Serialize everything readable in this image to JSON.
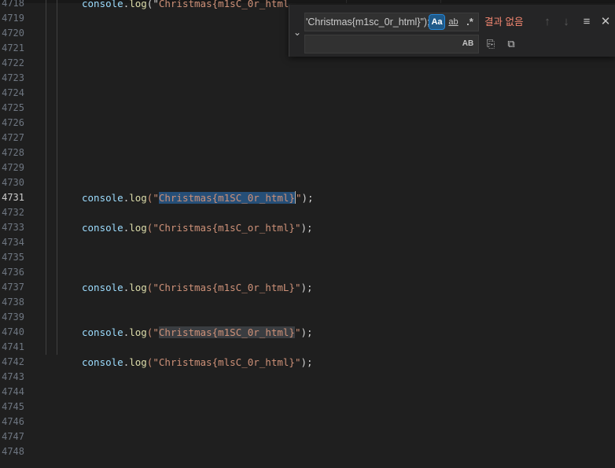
{
  "editor": {
    "lines": [
      {
        "num": "4718",
        "tokens": [
          {
            "t": "console",
            "c": "t-obj"
          },
          {
            "t": ".",
            "c": "t-pun"
          },
          {
            "t": "log",
            "c": "t-fn"
          },
          {
            "t": "(\"",
            "c": "t-pun"
          },
          {
            "t": "Christmas{m1sC_0r_html",
            "c": "t-str"
          }
        ]
      },
      {
        "num": "4719",
        "tokens": []
      },
      {
        "num": "4720",
        "tokens": []
      },
      {
        "num": "4721",
        "tokens": []
      },
      {
        "num": "4722",
        "tokens": []
      },
      {
        "num": "4723",
        "tokens": []
      },
      {
        "num": "4724",
        "tokens": []
      },
      {
        "num": "4725",
        "tokens": []
      },
      {
        "num": "4726",
        "tokens": []
      },
      {
        "num": "4727",
        "tokens": []
      },
      {
        "num": "4728",
        "tokens": []
      },
      {
        "num": "4729",
        "tokens": []
      },
      {
        "num": "4730",
        "tokens": []
      },
      {
        "num": "4731",
        "active": true,
        "tokens": [
          {
            "t": "console",
            "c": "t-obj"
          },
          {
            "t": ".",
            "c": "t-pun"
          },
          {
            "t": "log",
            "c": "t-fn"
          },
          {
            "t": "(\"",
            "c": "t-str"
          },
          {
            "t": "Christmas{m1SC_0r_html}",
            "c": "t-str",
            "hl": "hl-sel"
          },
          {
            "cursor": true
          },
          {
            "t": "\"",
            "c": "t-str"
          },
          {
            "t": ");",
            "c": "t-pun"
          }
        ]
      },
      {
        "num": "4732",
        "tokens": []
      },
      {
        "num": "4733",
        "tokens": [
          {
            "t": "console",
            "c": "t-obj"
          },
          {
            "t": ".",
            "c": "t-pun"
          },
          {
            "t": "log",
            "c": "t-fn"
          },
          {
            "t": "(\"Christmas{m1sC_or_html}\"",
            "c": "t-str"
          },
          {
            "t": ");",
            "c": "t-pun"
          }
        ]
      },
      {
        "num": "4734",
        "tokens": []
      },
      {
        "num": "4735",
        "tokens": []
      },
      {
        "num": "4736",
        "tokens": []
      },
      {
        "num": "4737",
        "tokens": [
          {
            "t": "console",
            "c": "t-obj"
          },
          {
            "t": ".",
            "c": "t-pun"
          },
          {
            "t": "log",
            "c": "t-fn"
          },
          {
            "t": "(\"Christmas{m1sC_0r_htmL}\"",
            "c": "t-str"
          },
          {
            "t": ");",
            "c": "t-pun"
          }
        ]
      },
      {
        "num": "4738",
        "tokens": []
      },
      {
        "num": "4739",
        "tokens": []
      },
      {
        "num": "4740",
        "tokens": [
          {
            "t": "console",
            "c": "t-obj"
          },
          {
            "t": ".",
            "c": "t-pun"
          },
          {
            "t": "log",
            "c": "t-fn"
          },
          {
            "t": "(\"",
            "c": "t-str"
          },
          {
            "t": "Christmas{m1SC_0r_html}",
            "c": "t-str",
            "hl": "hl-match"
          },
          {
            "t": "\"",
            "c": "t-str"
          },
          {
            "t": ");",
            "c": "t-pun"
          }
        ]
      },
      {
        "num": "4741",
        "tokens": []
      },
      {
        "num": "4742",
        "tokens": [
          {
            "t": "console",
            "c": "t-obj"
          },
          {
            "t": ".",
            "c": "t-pun"
          },
          {
            "t": "log",
            "c": "t-fn"
          },
          {
            "t": "(\"Christmas{mlsC_0r_html}\"",
            "c": "t-str"
          },
          {
            "t": ");",
            "c": "t-pun"
          }
        ]
      },
      {
        "num": "4743",
        "tokens": []
      },
      {
        "num": "4744",
        "tokens": []
      },
      {
        "num": "4745",
        "tokens": []
      },
      {
        "num": "4746",
        "tokens": []
      },
      {
        "num": "4747",
        "tokens": []
      },
      {
        "num": "4748",
        "tokens": []
      }
    ]
  },
  "find_widget": {
    "toggle_replace_icon": "chevron-down-icon",
    "toggle_replace_glyph": "⌄",
    "find_value": "'Christmas{m1sc_0r_html}\");",
    "match_case_label": "Aa",
    "match_case_active": true,
    "whole_word_label": "ab",
    "regex_label": ".*",
    "status": "결과 없음",
    "prev_glyph": "↑",
    "next_glyph": "↓",
    "selection_glyph": "≡",
    "close_glyph": "✕",
    "replace_value": "",
    "preserve_case_label": "AB",
    "replace_glyph": "⎘",
    "replace_all_glyph": "⧉"
  },
  "colors": {
    "background": "#1f1f1f",
    "selection": "#264f78",
    "match_highlight": "#3a3d41",
    "string": "#ce9178",
    "function": "#dcdcaa",
    "object": "#9cdcfe",
    "status_error": "#f48771"
  }
}
